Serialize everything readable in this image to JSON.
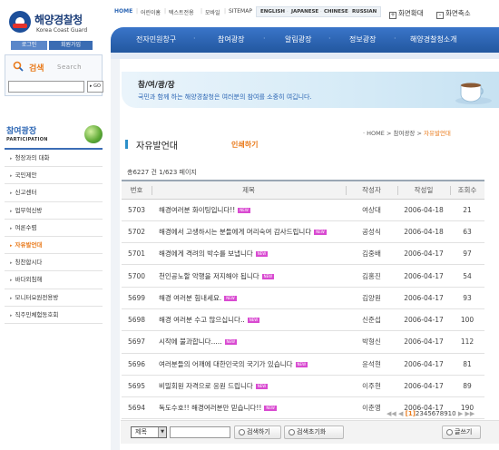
{
  "site": {
    "logo_ko": "해양경찰청",
    "logo_en": "Korea Coast Guard",
    "login_label": "로그인",
    "join_label": "회원가입"
  },
  "search_panel": {
    "label": "검색",
    "sub": "Search",
    "go_label": "GO"
  },
  "toplinks": {
    "items": [
      "HOME",
      "어린이홈",
      "텍스트전용",
      "모바일",
      "SITEMAP"
    ],
    "languages": [
      "ENGLISH",
      "JAPANESE",
      "CHINESE",
      "RUSSIAN"
    ],
    "zoom_in": "화면확대",
    "zoom_out": "화면축소"
  },
  "mainnav": [
    "전자민원창구",
    "참여광장",
    "알림광장",
    "정보광장",
    "해양경찰청소개"
  ],
  "sidebar": {
    "title": "참여광장",
    "subtitle": "PARTICIPATION",
    "items": [
      "청장과의 대화",
      "국민제안",
      "신고센터",
      "업무혁신방",
      "여론수렴",
      "자유발언대",
      "칭찬합시다",
      "바다외침해",
      "모니터요원전용방",
      "직주민체험동호회"
    ],
    "active_index": 5
  },
  "banner": {
    "title": "참/여/광/장",
    "desc": "국민과 함께 하는 해양경찰청은 여러분의 참여를 소중히 여깁니다."
  },
  "breadcrumb": {
    "home": "HOME",
    "sep": ">",
    "parent": "참여광장",
    "current": "자유발언대"
  },
  "page": {
    "title": "자유발언대",
    "subtitle": "인쇄하기",
    "total_text": "총6227 건 1/623 페이지"
  },
  "table": {
    "headers": [
      "번호",
      "제목",
      "작성자",
      "작성일",
      "조회수"
    ],
    "new_badge": "NEW",
    "rows": [
      {
        "no": "5703",
        "title": "해경여러분 화이팅입니다!!",
        "author": "여상대",
        "date": "2006-04-18",
        "views": "21"
      },
      {
        "no": "5702",
        "title": "해경에서 고생하시는 분들에게 머리숙여 감사드립니다",
        "author": "공성식",
        "date": "2006-04-18",
        "views": "63"
      },
      {
        "no": "5701",
        "title": "해경에게 격려의 박수를 보냅니다",
        "author": "김중배",
        "date": "2006-04-17",
        "views": "97"
      },
      {
        "no": "5700",
        "title": "천인공노할 악행을 저지해야 됩니다",
        "author": "김홍진",
        "date": "2006-04-17",
        "views": "54"
      },
      {
        "no": "5699",
        "title": "해경 여러분 힘내세요.",
        "author": "김양원",
        "date": "2006-04-17",
        "views": "93"
      },
      {
        "no": "5698",
        "title": "해경 여러분 수고 많으십니다..",
        "author": "신준섭",
        "date": "2006-04-17",
        "views": "100"
      },
      {
        "no": "5697",
        "title": "시작에 불과합니다.....",
        "author": "박형신",
        "date": "2006-04-17",
        "views": "112"
      },
      {
        "no": "5696",
        "title": "여러분들의 어깨에 대한민국의 국기가 있습니다",
        "author": "윤석현",
        "date": "2006-04-17",
        "views": "81"
      },
      {
        "no": "5695",
        "title": "비밀회원 자격으로 응원 드립니다",
        "author": "이주현",
        "date": "2006-04-17",
        "views": "89"
      },
      {
        "no": "5694",
        "title": "독도수호!! 해경여러분만 믿습니다!!",
        "author": "이춘영",
        "date": "2006-04-17",
        "views": "190"
      }
    ]
  },
  "pager": {
    "first": "◀◀",
    "prev": "◀",
    "pages": [
      "[1]",
      "2",
      "3",
      "4",
      "5",
      "6",
      "7",
      "8",
      "9",
      "10"
    ],
    "next": "▶",
    "last": "▶▶"
  },
  "searchbar": {
    "select_value": "제목",
    "search_label": "검색하기",
    "reset_label": "검색초기화",
    "write_label": "글쓰기"
  },
  "colors": {
    "nav_blue": "#22579f",
    "accent_orange": "#e97a1b",
    "new_badge": "#d94ad1"
  }
}
